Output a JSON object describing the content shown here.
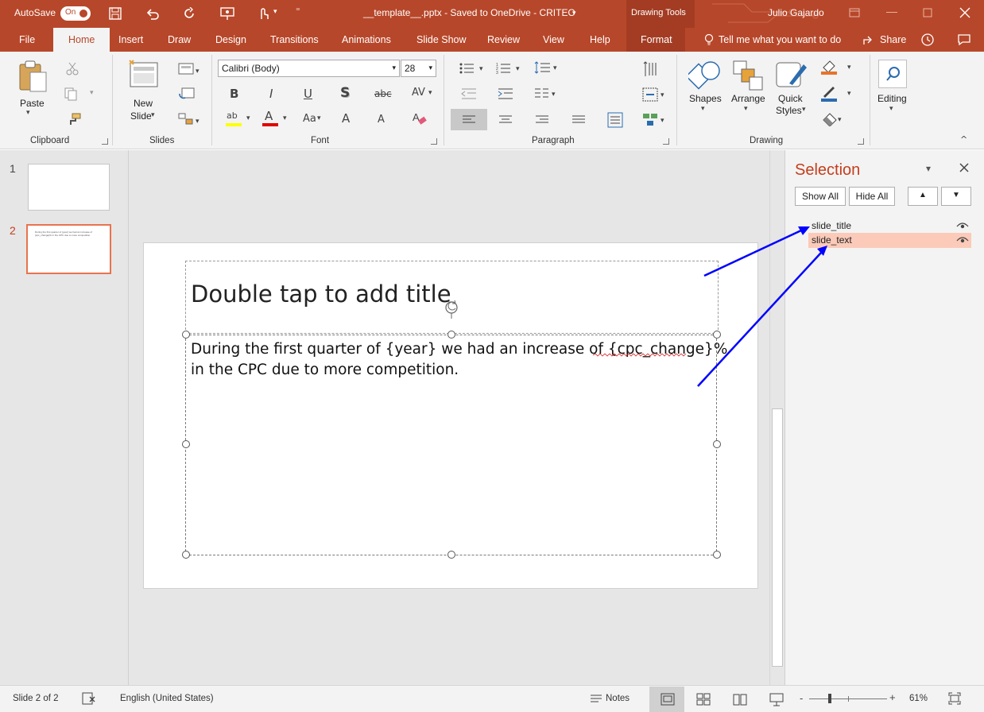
{
  "titlebar": {
    "autosave_label": "AutoSave",
    "autosave_state": "On",
    "document_title": "__template__.pptx  -  Saved to OneDrive - CRITEO",
    "context_tools": "Drawing Tools",
    "user_name": "Julio Gajardo"
  },
  "tabs": [
    "File",
    "Home",
    "Insert",
    "Draw",
    "Design",
    "Transitions",
    "Animations",
    "Slide Show",
    "Review",
    "View",
    "Help",
    "Format"
  ],
  "tellme": "Tell me what you want to do",
  "share": "Share",
  "ribbon": {
    "clipboard": {
      "paste": "Paste",
      "label": "Clipboard"
    },
    "slides": {
      "new_slide_1": "New",
      "new_slide_2": "Slide",
      "label": "Slides"
    },
    "font": {
      "font_name": "Calibri (Body)",
      "font_size": "28",
      "label": "Font",
      "bold": "B",
      "italic": "I",
      "underline": "U",
      "shadow": "S",
      "strike": "abc",
      "spacing": "AV",
      "case": "Aa",
      "grow": "A",
      "shrink": "A",
      "highlight": "ab",
      "color": "A"
    },
    "paragraph": {
      "label": "Paragraph"
    },
    "drawing": {
      "shapes": "Shapes",
      "arrange": "Arrange",
      "quick_1": "Quick",
      "quick_2": "Styles",
      "label": "Drawing"
    },
    "editing": {
      "label": "Editing"
    }
  },
  "thumbnails": [
    {
      "number": "1",
      "preview_text": ""
    },
    {
      "number": "2",
      "preview_text": "During the first quarter of {year} we had an increase of {cpc_change}% in the CPC due to more competition."
    }
  ],
  "slide": {
    "title": "Double tap to add title",
    "body_line1": "During the first quarter of {year} we had an increase of {cpc_change}%",
    "body_line2": "in the CPC due to more competition."
  },
  "selection_pane": {
    "title": "Selection",
    "show_all": "Show All",
    "hide_all": "Hide All",
    "items": [
      {
        "name": "slide_title",
        "selected": false
      },
      {
        "name": "slide_text",
        "selected": true
      }
    ]
  },
  "statusbar": {
    "slide_info": "Slide 2 of 2",
    "language": "English (United States)",
    "notes": "Notes",
    "zoom": "61%",
    "zoom_minus": "-",
    "zoom_plus": "+"
  },
  "colors": {
    "brand": "#b7472a",
    "selection_highlight": "#fbcab9",
    "annotation_arrow": "#0000ff"
  }
}
